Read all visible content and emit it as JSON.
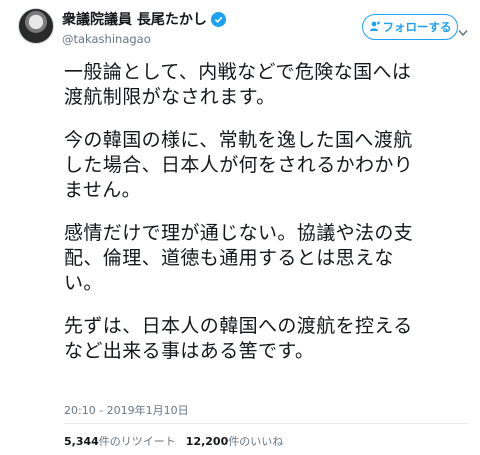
{
  "user": {
    "display_name": "衆議院議員 長尾たかし",
    "handle": "@takashinagao",
    "verified": true
  },
  "follow_button": {
    "label": "フォローする",
    "icon": "follow-plus-icon"
  },
  "tweet": {
    "paragraphs": [
      "一般論として、内戦などで危険な国へは\n渡航制限がなされます。",
      "今の韓国の様に、常軌を逸した国へ渡航\nした場合、日本人が何をされるかわかり\nません。",
      "感情だけで理が通じない。協議や法の支\n配、倫理、道徳も通用するとは思えな\nい。",
      "先ずは、日本人の韓国への渡航を控える\nなど出来る事はある筈です。"
    ],
    "timestamp": "20:10 - 2019年1月10日"
  },
  "stats": {
    "retweets_count": "5,344",
    "retweets_label": "件のリツイート",
    "likes_count": "12,200",
    "likes_label": "件のいいね"
  },
  "colors": {
    "accent": "#1da1f2",
    "text": "#14171a",
    "muted": "#657786"
  }
}
